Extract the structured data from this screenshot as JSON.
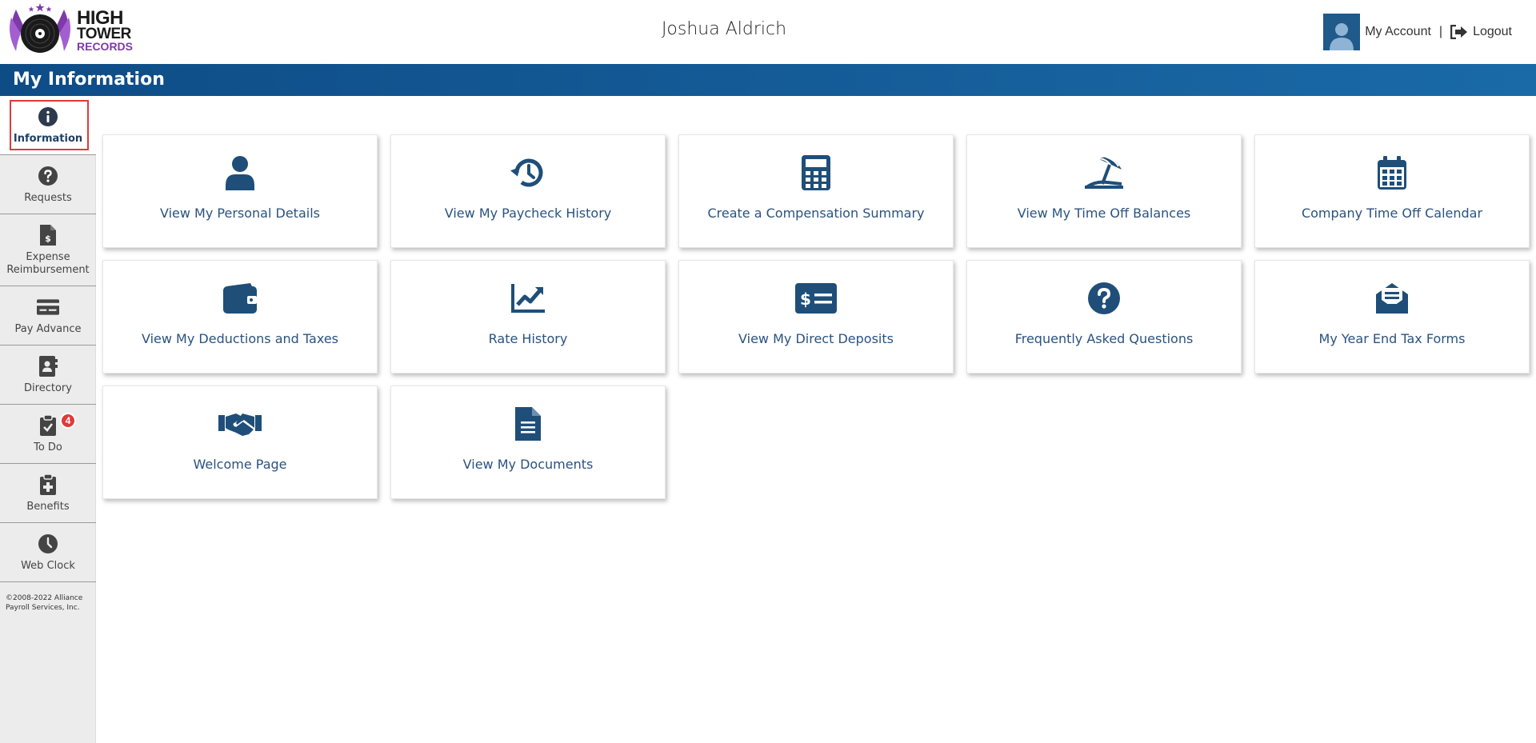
{
  "header": {
    "logo": {
      "line1": "HIGH",
      "line2": "TOWER",
      "line3": "RECORDS"
    },
    "user_name": "Joshua Aldrich",
    "my_account": "My Account",
    "separator": "|",
    "logout": "Logout"
  },
  "page_title": "My Information",
  "sidebar": {
    "items": [
      {
        "label": "Information",
        "icon": "info-icon",
        "active": true
      },
      {
        "label": "Requests",
        "icon": "question-icon"
      },
      {
        "label": "Expense Reimbursement",
        "icon": "receipt-icon"
      },
      {
        "label": "Pay Advance",
        "icon": "credit-card-icon"
      },
      {
        "label": "Directory",
        "icon": "address-book-icon"
      },
      {
        "label": "To Do",
        "icon": "clipboard-check-icon",
        "badge": "4"
      },
      {
        "label": "Benefits",
        "icon": "clipboard-plus-icon"
      },
      {
        "label": "Web Clock",
        "icon": "clock-icon"
      }
    ],
    "copyright": "©2008-2022 Alliance Payroll Services, Inc."
  },
  "tiles": [
    {
      "label": "View My Personal Details",
      "icon": "user-icon"
    },
    {
      "label": "View My Paycheck History",
      "icon": "history-icon"
    },
    {
      "label": "Create a Compensation Summary",
      "icon": "calculator-icon"
    },
    {
      "label": "View My Time Off Balances",
      "icon": "beach-umbrella-icon"
    },
    {
      "label": "Company Time Off Calendar",
      "icon": "calendar-icon"
    },
    {
      "label": "View My Deductions and Taxes",
      "icon": "wallet-icon"
    },
    {
      "label": "Rate History",
      "icon": "chart-line-icon"
    },
    {
      "label": "View My Direct Deposits",
      "icon": "money-check-icon"
    },
    {
      "label": "Frequently Asked Questions",
      "icon": "question-icon"
    },
    {
      "label": "My Year End Tax Forms",
      "icon": "envelope-open-text-icon"
    },
    {
      "label": "Welcome Page",
      "icon": "handshake-icon"
    },
    {
      "label": "View My Documents",
      "icon": "document-icon"
    }
  ],
  "colors": {
    "brand_blue": "#1f4e79",
    "title_bar_start": "#0e4c86",
    "title_bar_end": "#1a6aa8",
    "tile_text": "#2a527f",
    "badge_red": "#e03a3a",
    "active_outline": "#e0393c",
    "logo_purple": "#7d3aa8"
  }
}
